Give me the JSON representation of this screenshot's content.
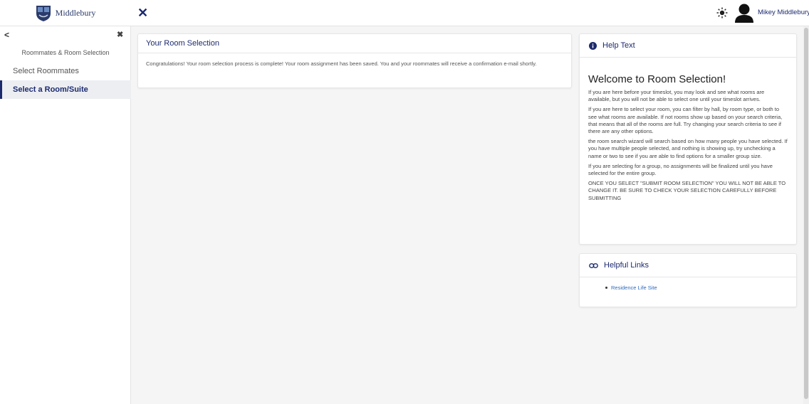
{
  "header": {
    "logo_text": "Middlebury",
    "close_icon": "close-icon",
    "theme_icon": "sun-icon",
    "user_name": "Mikey Middlebury"
  },
  "sidebar": {
    "back_icon": "chevron-left-icon",
    "close_icon": "close-icon",
    "heading": "Roommates & Room Selection",
    "items": [
      {
        "label": "Select Roommates",
        "active": false
      },
      {
        "label": "Select a Room/Suite",
        "active": true
      }
    ]
  },
  "main": {
    "card_title": "Your Room Selection",
    "message": "Congratulations! Your room selection process is complete! Your room assignment has been saved. You and your roommates will receive a confirmation e-mail shortly."
  },
  "help": {
    "header": "Help Text",
    "icon": "info-icon",
    "title": "Welcome to Room Selection!",
    "paragraphs": [
      "If you are here before your timeslot, you may look and see what rooms are available, but you will not be able to select one until your timeslot arrives.",
      "If you are here to select your room, you can filter by hall, by room type, or both to see what rooms are available. If not rooms show up based on your search criteria, that means that all of the rooms are full. Try changing your search criteria to see if there are any other options.",
      "the room search wizard will search based on how many people you have selected. If you have multiple people selected, and nothing is showing up, try unchecking a name or two to see if you are able to find options for a smaller group size.",
      "If you are selecting for a group, no assignments will be finalized until you have selected for the entire group.",
      "ONCE YOU SELECT \"SUBMIT ROOM SELECTION\" YOU WILL NOT BE ABLE TO CHANGE IT. BE SURE TO CHECK YOUR SELECTION CAREFULLY BEFORE SUBMITTING"
    ]
  },
  "links": {
    "header": "Helpful Links",
    "icon": "link-icon",
    "items": [
      "Residence Life Site"
    ]
  },
  "colors": {
    "brand": "#1c2a6e",
    "link": "#2f6bbf",
    "background": "#f5f5f5"
  }
}
